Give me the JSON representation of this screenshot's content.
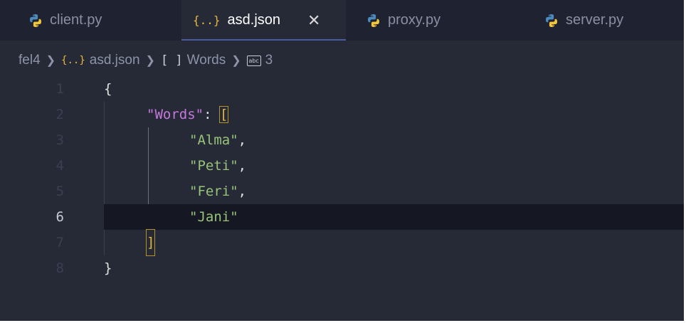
{
  "tabs": [
    {
      "label": "client.py",
      "icon": "python-icon",
      "active": false
    },
    {
      "label": "asd.json",
      "icon": "json-icon",
      "active": true
    },
    {
      "label": "proxy.py",
      "icon": "python-icon",
      "active": false
    },
    {
      "label": "server.py",
      "icon": "python-icon",
      "active": false
    }
  ],
  "json_icon_glyph": "{..}",
  "close_glyph": "✕",
  "breadcrumb": {
    "folder": "fel4",
    "file": "asd.json",
    "brackets": "[ ]",
    "array": "Words",
    "item": "3"
  },
  "editor": {
    "line_numbers": [
      "1",
      "2",
      "3",
      "4",
      "5",
      "6",
      "7",
      "8"
    ],
    "current_line": "6",
    "lines": [
      {
        "n": "1",
        "open_brace": "{"
      },
      {
        "n": "2",
        "key": "\"Words\"",
        "colon": ": ",
        "bracket": "["
      },
      {
        "n": "3",
        "str": "\"Alma\"",
        "comma": ","
      },
      {
        "n": "4",
        "str": "\"Peti\"",
        "comma": ","
      },
      {
        "n": "5",
        "str": "\"Feri\"",
        "comma": ","
      },
      {
        "n": "6",
        "str": "\"Jani\"",
        "comma": ""
      },
      {
        "n": "7",
        "bracket": "]"
      },
      {
        "n": "8",
        "close_brace": "}"
      }
    ]
  },
  "colors": {
    "background": "#262a37",
    "tabbar": "#1f2230",
    "current_line": "#151722",
    "key": "#c678dd",
    "string": "#98c379",
    "bracket": "#e8b73d"
  }
}
